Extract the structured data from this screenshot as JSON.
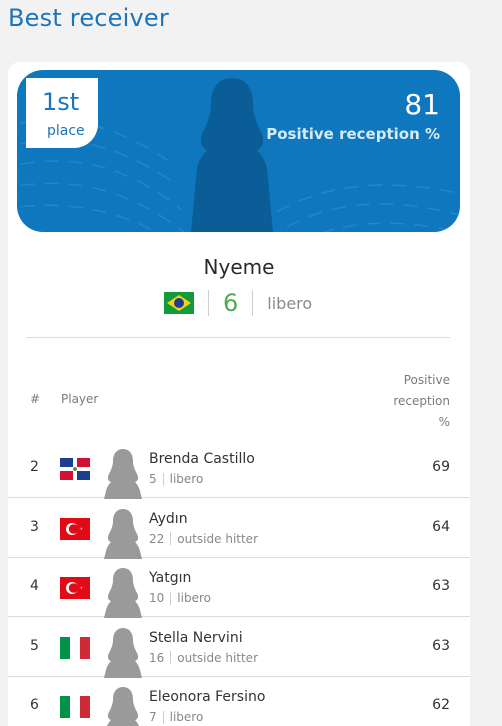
{
  "page": {
    "title": "Best receiver"
  },
  "leader": {
    "place_number": "1st",
    "place_label": "place",
    "value": "81",
    "stat_caption": "Positive reception %",
    "name": "Nyeme",
    "jersey": "6",
    "role": "libero",
    "flag_icon": "brazil-flag-icon"
  },
  "table": {
    "headers": {
      "rank": "#",
      "player": "Player",
      "stat_lines": [
        "Positive",
        "reception",
        "%"
      ]
    },
    "rows": [
      {
        "rank": "2",
        "name": "Brenda Castillo",
        "jersey": "5",
        "role": "libero",
        "value": "69",
        "flag_icon": "dominican-republic-flag-icon"
      },
      {
        "rank": "3",
        "name": "Aydın",
        "jersey": "22",
        "role": "outside hitter",
        "value": "64",
        "flag_icon": "turkey-flag-icon"
      },
      {
        "rank": "4",
        "name": "Yatgın",
        "jersey": "10",
        "role": "libero",
        "value": "63",
        "flag_icon": "turkey-flag-icon"
      },
      {
        "rank": "5",
        "name": "Stella Nervini",
        "jersey": "16",
        "role": "outside hitter",
        "value": "63",
        "flag_icon": "italy-flag-icon"
      },
      {
        "rank": "6",
        "name": "Eleonora Fersino",
        "jersey": "7",
        "role": "libero",
        "value": "62",
        "flag_icon": "italy-flag-icon"
      }
    ]
  },
  "colors": {
    "accent": "#1b75bb",
    "hero_bg": "#0f77bd",
    "jersey_green": "#4cae4f"
  }
}
